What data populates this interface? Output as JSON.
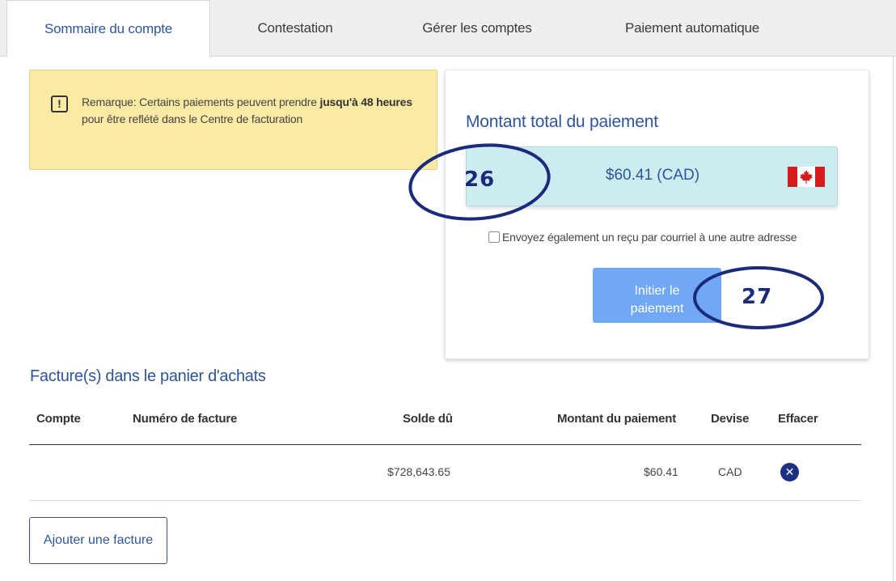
{
  "tabs": [
    {
      "label": "Sommaire du compte"
    },
    {
      "label": "Contestation"
    },
    {
      "label": "Gérer les comptes"
    },
    {
      "label": "Paiement automatique"
    }
  ],
  "notice": {
    "text_before": "Remarque: Certains paiements peuvent prendre ",
    "text_bold": "jusqu'à 48 heures",
    "text_after": " pour être reflété dans le Centre de facturation",
    "icon": "exclamation-icon"
  },
  "payment": {
    "title": "Montant total du paiement",
    "amount": "$60.41 (CAD)",
    "flag": "canada-flag-icon",
    "receipt_label": "Envoyez également un reçu par courriel à une autre adresse",
    "button_line1": "Initier le",
    "button_line2": "paiement"
  },
  "annotations": {
    "first": "26",
    "second": "27",
    "color": "#1c2a7c"
  },
  "cart": {
    "title": "Facture(s) dans le panier d'achats",
    "columns": [
      "Compte",
      "Numéro de facture",
      "Solde dû",
      "Montant du paiement",
      "Devise",
      "Effacer"
    ],
    "rows": [
      {
        "compte": "",
        "numero": "",
        "solde": "$728,643.65",
        "montant": "$60.41",
        "devise": "CAD",
        "effacer": "close-icon"
      }
    ],
    "add_button": "Ajouter une facture"
  },
  "colors": {
    "accent": "#2e5597",
    "notice_bg": "#fbeaa4",
    "amount_bg": "#cdecf2",
    "button_bg": "#70a8f5",
    "clear_bg": "#1d2f82"
  }
}
